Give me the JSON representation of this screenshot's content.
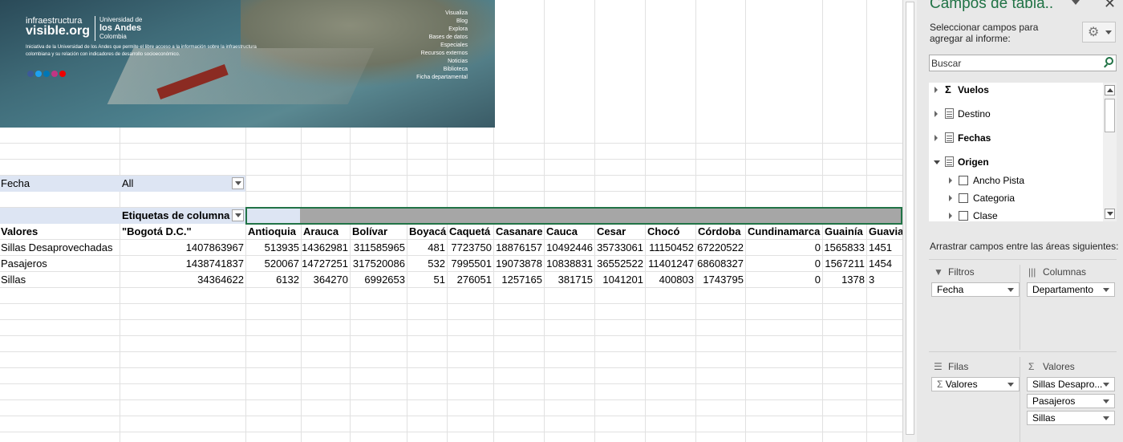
{
  "banner": {
    "logo_line1": "infraestructura",
    "logo_line2": "visible.org",
    "university_small": "Universidad de",
    "university_big": "los Andes",
    "university_country": "Colombia",
    "tagline": "Iniciativa de la Universidad de los Andes que permite el libre acceso a la información sobre la infraestructura colombiana y su relación con indicadores de desarrollo socioeconómico.",
    "menu": [
      "Visualiza",
      "Blog",
      "Explora",
      "Bases de datos",
      "Especiales",
      "Recursos externos",
      "Noticias",
      "Biblioteca",
      "Ficha departamental"
    ]
  },
  "pivot": {
    "filter_label": "Fecha",
    "filter_value": "All",
    "values_header": "Valores",
    "column_labels_header": "Etiquetas de columna",
    "columns": [
      "\"Bogotá D.C.\"",
      "Antioquia",
      "Arauca",
      "Bolívar",
      "Boyacá",
      "Caquetá",
      "Casanare",
      "Cauca",
      "Cesar",
      "Chocó",
      "Córdoba",
      "Cundinamarca",
      "Guainía",
      "Guaviare"
    ],
    "rows": [
      {
        "label": "Sillas Desaprovechadas",
        "values": [
          "1407863967",
          "513935",
          "14362981",
          "311585965",
          "481",
          "7723750",
          "18876157",
          "10492446",
          "35733061",
          "11150452",
          "67220522",
          "0",
          "1565833",
          "1451"
        ]
      },
      {
        "label": "Pasajeros",
        "values": [
          "1438741837",
          "520067",
          "14727251",
          "317520086",
          "532",
          "7995501",
          "19073878",
          "10838831",
          "36552522",
          "11401247",
          "68608327",
          "0",
          "1567211",
          "1454"
        ]
      },
      {
        "label": "Sillas",
        "values": [
          "34364622",
          "6132",
          "364270",
          "6992653",
          "51",
          "276051",
          "1257165",
          "381715",
          "1041201",
          "400803",
          "1743795",
          "0",
          "1378",
          "3"
        ]
      }
    ]
  },
  "panel": {
    "title": "Campos de tabla..",
    "subtitle": "Seleccionar campos para agregar al informe:",
    "search_placeholder": "Buscar",
    "fields": [
      {
        "label": "Vuelos",
        "kind": "sigma",
        "bold": true
      },
      {
        "label": "Destino",
        "kind": "table",
        "bold": false
      },
      {
        "label": "Fechas",
        "kind": "table",
        "bold": true
      },
      {
        "label": "Origen",
        "kind": "table",
        "bold": true,
        "open": true
      },
      {
        "label": "Ancho Pista",
        "kind": "check"
      },
      {
        "label": "Categoria",
        "kind": "check"
      },
      {
        "label": "Clase",
        "kind": "check"
      }
    ],
    "drag_hint": "Arrastrar campos entre las áreas siguientes:",
    "areas": {
      "filters": {
        "title": "Filtros",
        "items": [
          "Fecha"
        ]
      },
      "columns": {
        "title": "Columnas",
        "items": [
          "Departamento"
        ]
      },
      "rows": {
        "title": "Filas",
        "items": [
          "Valores"
        ]
      },
      "values": {
        "title": "Valores",
        "items": [
          "Sillas Desapro...",
          "Pasajeros",
          "Sillas"
        ]
      }
    }
  }
}
